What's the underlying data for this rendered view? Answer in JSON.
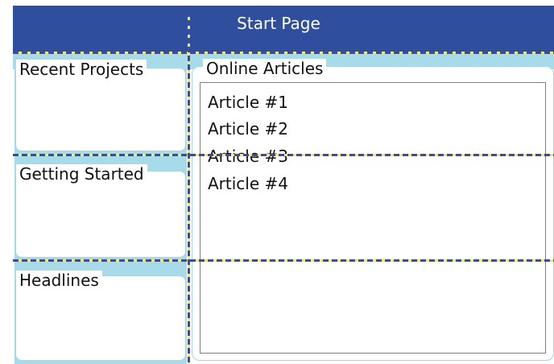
{
  "header": {
    "title": "Start Page"
  },
  "panels": {
    "recent_projects": "Recent Projects",
    "getting_started": "Getting Started",
    "headlines": "Headlines"
  },
  "articles": {
    "title": "Online Articles",
    "items": [
      "Article #1",
      "Article #2",
      "Article #3",
      "Article #4"
    ]
  },
  "colors": {
    "header_bg": "#2f4e9d",
    "band_bg": "#a7dbe9",
    "dash_primary": "#3f4a9a",
    "dash_secondary": "#e8ef6a"
  }
}
